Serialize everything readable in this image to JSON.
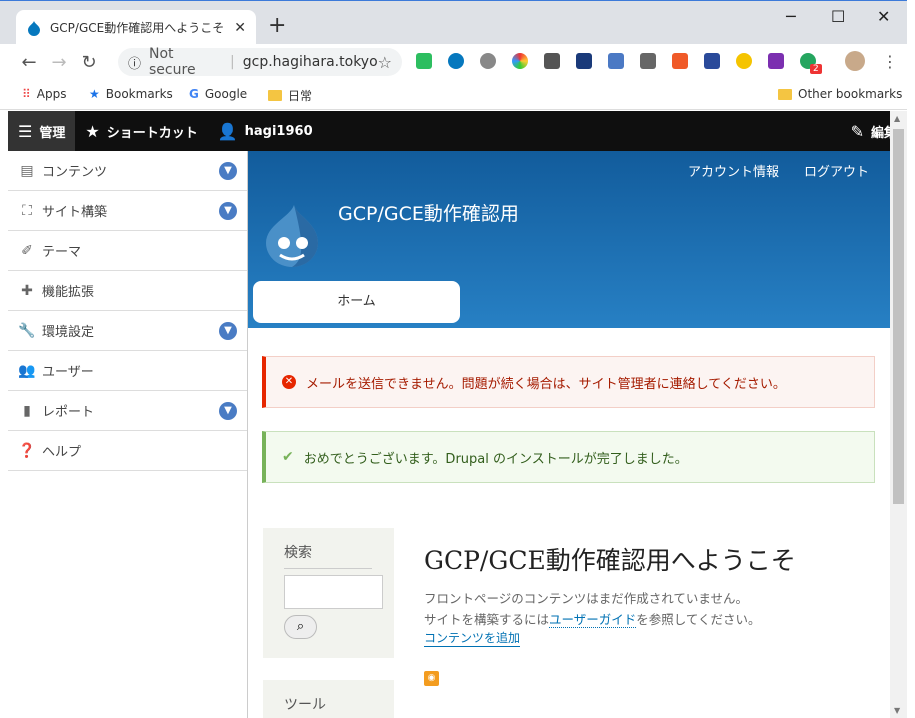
{
  "browser": {
    "tab_title": "GCP/GCE動作確認用へようこそ | GC",
    "tab_close": "✕",
    "new_tab": "+",
    "controls": {
      "minimize": "─",
      "maximize": "☐",
      "close": "✕"
    },
    "url_security": "Not secure",
    "url": "gcp.hagihara.tokyo",
    "bookmarks": {
      "apps": "Apps",
      "bookmarks": "Bookmarks",
      "google": "Google",
      "folder": "日常",
      "other": "Other bookmarks"
    },
    "badge_count": "2"
  },
  "admin_toolbar": {
    "manage": "管理",
    "shortcuts": "ショートカット",
    "user": "hagi1960",
    "edit": "編集"
  },
  "sidebar": {
    "items": [
      {
        "label": "コンテンツ",
        "icon": "file-icon",
        "expandable": true
      },
      {
        "label": "サイト構築",
        "icon": "sitemap-icon",
        "expandable": true
      },
      {
        "label": "テーマ",
        "icon": "paintbrush-icon",
        "expandable": false
      },
      {
        "label": "機能拡張",
        "icon": "puzzle-icon",
        "expandable": false
      },
      {
        "label": "環境設定",
        "icon": "wrench-icon",
        "expandable": true
      },
      {
        "label": "ユーザー",
        "icon": "people-icon",
        "expandable": false
      },
      {
        "label": "レポート",
        "icon": "bar-chart-icon",
        "expandable": true
      },
      {
        "label": "ヘルプ",
        "icon": "help-icon",
        "expandable": false
      }
    ]
  },
  "site": {
    "account_link": "アカウント情報",
    "logout_link": "ログアウト",
    "name": "GCP/GCE動作確認用",
    "home_tab": "ホーム"
  },
  "messages": {
    "error": "メールを送信できません。問題が続く場合は、サイト管理者に連絡してください。",
    "status": "おめでとうございます。Drupal のインストールが完了しました。"
  },
  "blocks": {
    "search_title": "検索",
    "tools_title": "ツール"
  },
  "content": {
    "title": "GCP/GCE動作確認用へようこそ",
    "line1": "フロントページのコンテンツはまだ作成されていません。",
    "line2_prefix": "サイトを構築するには",
    "line2_link": "ユーザーガイド",
    "line2_suffix": "を参照してください。",
    "add_link": "コンテンツを追加"
  },
  "colors": {
    "header_top": "#125c9c",
    "header_bottom": "#2780c4",
    "error_accent": "#e62600",
    "status_accent": "#77b259",
    "link": "#0071b3"
  }
}
